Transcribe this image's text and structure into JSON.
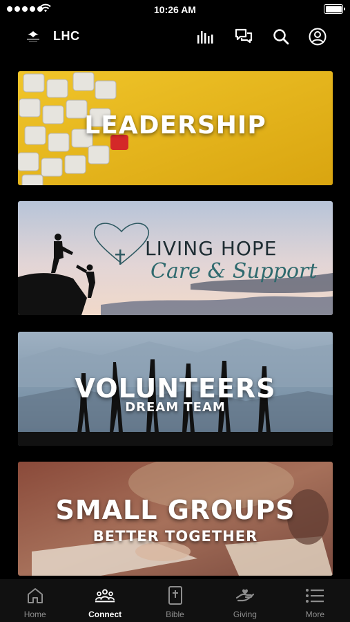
{
  "status_bar": {
    "time": "10:26 AM"
  },
  "header": {
    "title": "LHC"
  },
  "cards": [
    {
      "title": "LEADERSHIP"
    },
    {
      "title": "LIVING HOPE",
      "subtitle": "Care & Support"
    },
    {
      "title": "VOLUNTEERS",
      "subtitle": "DREAM TEAM"
    },
    {
      "title": "SMALL GROUPS",
      "subtitle": "BETTER TOGETHER"
    }
  ],
  "tabs": [
    {
      "label": "Home",
      "icon": "home-icon"
    },
    {
      "label": "Connect",
      "icon": "people-icon",
      "active": true
    },
    {
      "label": "Bible",
      "icon": "bible-icon"
    },
    {
      "label": "Giving",
      "icon": "giving-hand-icon"
    },
    {
      "label": "More",
      "icon": "list-icon"
    }
  ],
  "colors": {
    "background": "#000000",
    "tab_active": "#ffffff",
    "tab_inactive": "#8e8e8e",
    "leadership_yellow": "#e8b71c"
  }
}
